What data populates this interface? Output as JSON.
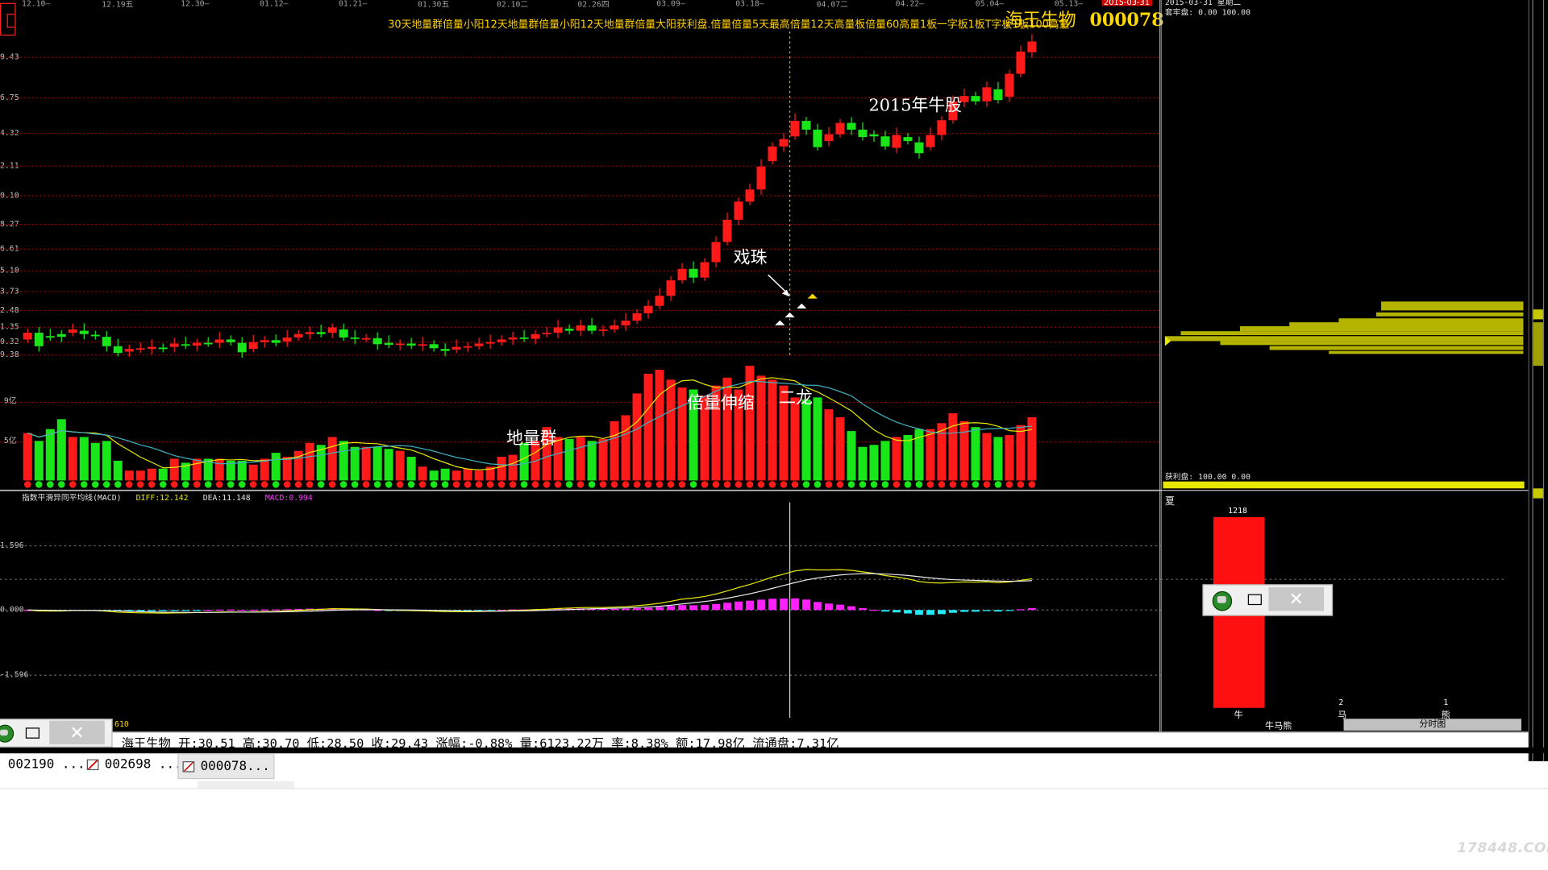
{
  "colors": {
    "up": "#ff1a1a",
    "down": "#19e619",
    "bg": "#000000",
    "grid": "#8a0000",
    "ma1": "#e8e8e8",
    "ma2": "#e6e600",
    "macd_pos": "#ff22ff",
    "macd_neg": "#22eaff",
    "chip": "#b3b300",
    "title": "#ffd700"
  },
  "header": {
    "dates": [
      "12.10—",
      "12.19五",
      "12.30—",
      "01.12—",
      "01.21—",
      "01.30五",
      "02.10二",
      "02.26四",
      "03.09—",
      "03.18—",
      "04.07二",
      "04.22—",
      "05.04—",
      "05.13—"
    ],
    "date_tag": "2015-03-31",
    "signals_text": "30天地量群倍量小阳12天地量群倍量小阳12天地量群倍量大阳获利盘.倍量倍量5天最高倍量12天高量板倍量60高量1板一字板1板T字板1板100高量",
    "stock_name": "海王生物",
    "stock_code": "000078"
  },
  "y_axis": {
    "price_labels": [
      "9.43",
      "6.75",
      "4.32",
      "2.11",
      "0.10",
      "8.27",
      "6.61",
      "5.10",
      "3.73",
      "2.48",
      "1.35",
      "0.32",
      "9.38"
    ],
    "volume_labels": [
      "9亿",
      "5亿"
    ],
    "macd_labels": [
      "1.596",
      "0.000",
      "-1.596"
    ]
  },
  "annotations": {
    "niu": "2015年牛股",
    "xizhu": "戏珠",
    "beiliang": "倍量伸缩",
    "erlong": "二龙",
    "diliang": "地量群"
  },
  "macd_legend": {
    "title": "指数平滑异同平均线(MACD)",
    "diff": "DIFF:12.142",
    "dea": "DEA:11.148",
    "macd": "MACD:0.994"
  },
  "right_panel": {
    "date_line": "2015-03-31 星期二",
    "taolao": "套牢盘: 0.00 100.00",
    "huoli": "获利盘: 100.00 0.00",
    "xia": "夏",
    "niu_value": "1218",
    "niu_label": "牛",
    "ma_value": "2",
    "ma_label": "马",
    "xiong_value": "1",
    "xiong_label": "熊",
    "tab1": "牛马熊",
    "tab2": "分时图"
  },
  "status_bar": {
    "left_num": "610",
    "name": "海王生物",
    "open": "开:30.51",
    "high": "高:30.70",
    "low": "低:28.50",
    "close": "收:29.43",
    "change": "涨幅:-0.88%",
    "volume": "量:6123.22万",
    "rate": "率:8.38%",
    "amount": "额:17.98亿",
    "float": "流通盘:7.31亿"
  },
  "tabs": [
    "002190 ...",
    "002698 ...",
    "000078..."
  ],
  "watermark": "178448.COM",
  "chart_data": {
    "type": "candlestick",
    "title": "海王生物 000078",
    "candles": [
      [
        0,
        1
      ],
      [
        1,
        -1
      ],
      [
        0.5,
        0.3
      ],
      [
        0.8,
        0.4
      ],
      [
        1,
        1.5
      ],
      [
        1.3,
        0.8
      ],
      [
        0.7,
        0.5
      ],
      [
        0.4,
        -1
      ],
      [
        -1,
        -2
      ],
      [
        -1.8,
        -1.4
      ],
      [
        -1.5,
        -1.3
      ],
      [
        -1.4,
        -1.1
      ],
      [
        -1.2,
        -1.4
      ],
      [
        -1.1,
        -0.6
      ],
      [
        -0.7,
        -0.9
      ],
      [
        -0.9,
        -0.5
      ],
      [
        -0.5,
        -0.6
      ],
      [
        -0.5,
        0
      ],
      [
        0,
        -0.4
      ],
      [
        -0.5,
        -1.9
      ],
      [
        -1.4,
        -0.4
      ],
      [
        -0.4,
        -0.1
      ],
      [
        -0.1,
        -0.5
      ],
      [
        -0.3,
        0.3
      ],
      [
        0.3,
        0.8
      ],
      [
        0.8,
        1.1
      ],
      [
        1.1,
        0.8
      ],
      [
        1,
        1.8
      ],
      [
        1.5,
        0.3
      ],
      [
        0.3,
        0.1
      ],
      [
        0.1,
        0.2
      ],
      [
        0.2,
        -0.7
      ],
      [
        -0.5,
        -0.8
      ],
      [
        -0.8,
        -0.6
      ],
      [
        -0.6,
        -0.9
      ],
      [
        -0.9,
        -0.7
      ],
      [
        -0.7,
        -1.3
      ],
      [
        -1.4,
        -1.7
      ],
      [
        -1.5,
        -1.1
      ],
      [
        -1.1,
        -1
      ],
      [
        -1,
        -0.6
      ],
      [
        -0.6,
        -0.4
      ],
      [
        -0.4,
        0
      ],
      [
        0,
        0.3
      ],
      [
        0.3,
        0.1
      ],
      [
        0.1,
        0.8
      ],
      [
        0.8,
        1
      ],
      [
        1,
        1.8
      ],
      [
        1.6,
        1.3
      ],
      [
        1.3,
        2.1
      ],
      [
        2.1,
        1.3
      ],
      [
        1.3,
        1.5
      ],
      [
        1.5,
        2.1
      ],
      [
        2.1,
        2.8
      ],
      [
        2.8,
        3.9
      ],
      [
        3.9,
        5
      ],
      [
        5,
        6.5
      ],
      [
        6.5,
        8.8
      ],
      [
        8.8,
        10.5
      ],
      [
        10.5,
        9.2
      ],
      [
        9.2,
        11.5
      ],
      [
        11.5,
        14.5
      ],
      [
        14.5,
        17.8
      ],
      [
        17.8,
        20.5
      ],
      [
        20.5,
        22.3
      ],
      [
        22.3,
        25.7
      ],
      [
        26.5,
        28.7
      ],
      [
        28.7,
        29.8
      ],
      [
        30.2,
        32.5
      ],
      [
        32.5,
        31.2
      ],
      [
        31.2,
        28.6
      ],
      [
        29.5,
        30.5
      ],
      [
        30.5,
        32.2
      ],
      [
        32.2,
        31.2
      ],
      [
        31.2,
        30.1
      ],
      [
        30.5,
        30.2
      ],
      [
        30.2,
        28.7
      ],
      [
        28.5,
        30.4
      ],
      [
        30.1,
        29.5
      ],
      [
        29.3,
        27.7
      ],
      [
        28.6,
        30.4
      ],
      [
        30.4,
        32.6
      ],
      [
        32.6,
        35.4
      ],
      [
        35.3,
        36.2
      ],
      [
        36.2,
        35.4
      ],
      [
        35.4,
        37.5
      ],
      [
        37.2,
        35.6
      ],
      [
        36.1,
        39.5
      ],
      [
        39.5,
        42.8
      ],
      [
        42.7,
        44.3
      ]
    ],
    "volume": [
      24,
      20,
      26,
      31,
      22,
      22,
      19,
      20,
      10,
      5,
      5,
      6,
      6,
      11,
      9,
      11,
      11,
      11,
      10,
      10,
      8,
      11,
      14,
      12,
      15,
      19,
      18,
      22,
      20,
      17,
      17,
      17,
      16,
      15,
      12,
      7,
      5,
      6,
      5,
      6,
      5,
      7,
      12,
      13,
      19,
      20,
      27,
      22,
      21,
      22,
      20,
      21,
      30,
      33,
      44,
      54,
      56,
      51,
      47,
      46,
      43,
      48,
      52,
      46,
      58,
      53,
      51,
      48,
      42,
      41,
      42,
      36,
      32,
      25,
      17,
      18,
      20,
      22,
      23,
      26,
      26,
      29,
      34,
      30,
      27,
      24,
      22,
      23,
      28,
      32
    ],
    "volume_ylim": [
      0,
      60
    ]
  }
}
